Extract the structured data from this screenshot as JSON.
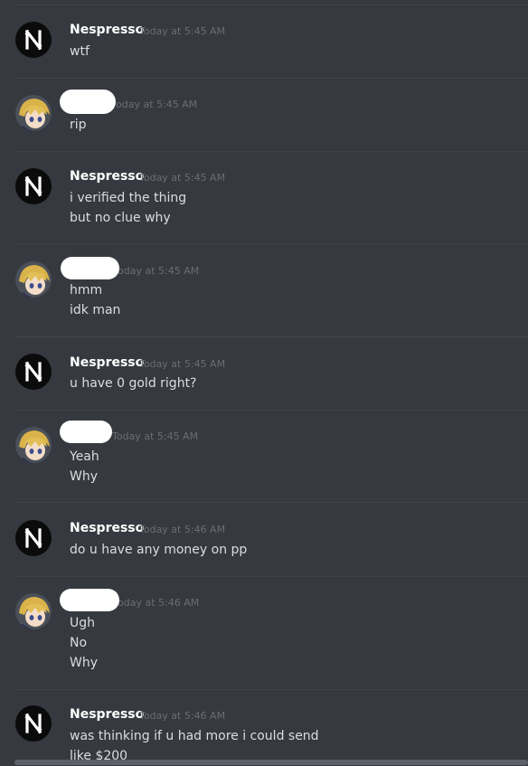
{
  "chat": {
    "messages": [
      {
        "author": "Nespresso",
        "avatar": "nespresso-logo",
        "timestamp": "Today at 5:45 AM",
        "lines": [
          "wtf"
        ]
      },
      {
        "author": "",
        "avatar": "anime-character",
        "timestamp": "oday at 5:45 AM",
        "lines": [
          "rip"
        ]
      },
      {
        "author": "Nespresso",
        "avatar": "nespresso-logo",
        "timestamp": "Today at 5:45 AM",
        "lines": [
          "i verified the thing",
          "but no clue why"
        ]
      },
      {
        "author": "",
        "avatar": "anime-character",
        "timestamp": "oday at 5:45 AM",
        "lines": [
          "hmm",
          "idk man"
        ]
      },
      {
        "author": "Nespresso",
        "avatar": "nespresso-logo",
        "timestamp": "Today at 5:45 AM",
        "lines": [
          "u have 0 gold right?"
        ]
      },
      {
        "author": "",
        "avatar": "anime-character",
        "timestamp": "Today at 5:45 AM",
        "lines": [
          "Yeah",
          "Why"
        ]
      },
      {
        "author": "Nespresso",
        "avatar": "nespresso-logo",
        "timestamp": "Today at 5:46 AM",
        "lines": [
          "do u have any money on pp"
        ]
      },
      {
        "author": "",
        "avatar": "anime-character",
        "timestamp": "oday at 5:46 AM",
        "lines": [
          "Ugh",
          "No",
          "Why"
        ]
      },
      {
        "author": "Nespresso",
        "avatar": "nespresso-logo",
        "timestamp": "Today at 5:46 AM",
        "lines": [
          "was thinking if u had more i could send",
          "like $200"
        ]
      }
    ]
  },
  "colors": {
    "background": "#36393f",
    "author": "#ffffff",
    "text": "#dcddde",
    "timestamp": "#6a6d73",
    "divider": "#40434a"
  }
}
